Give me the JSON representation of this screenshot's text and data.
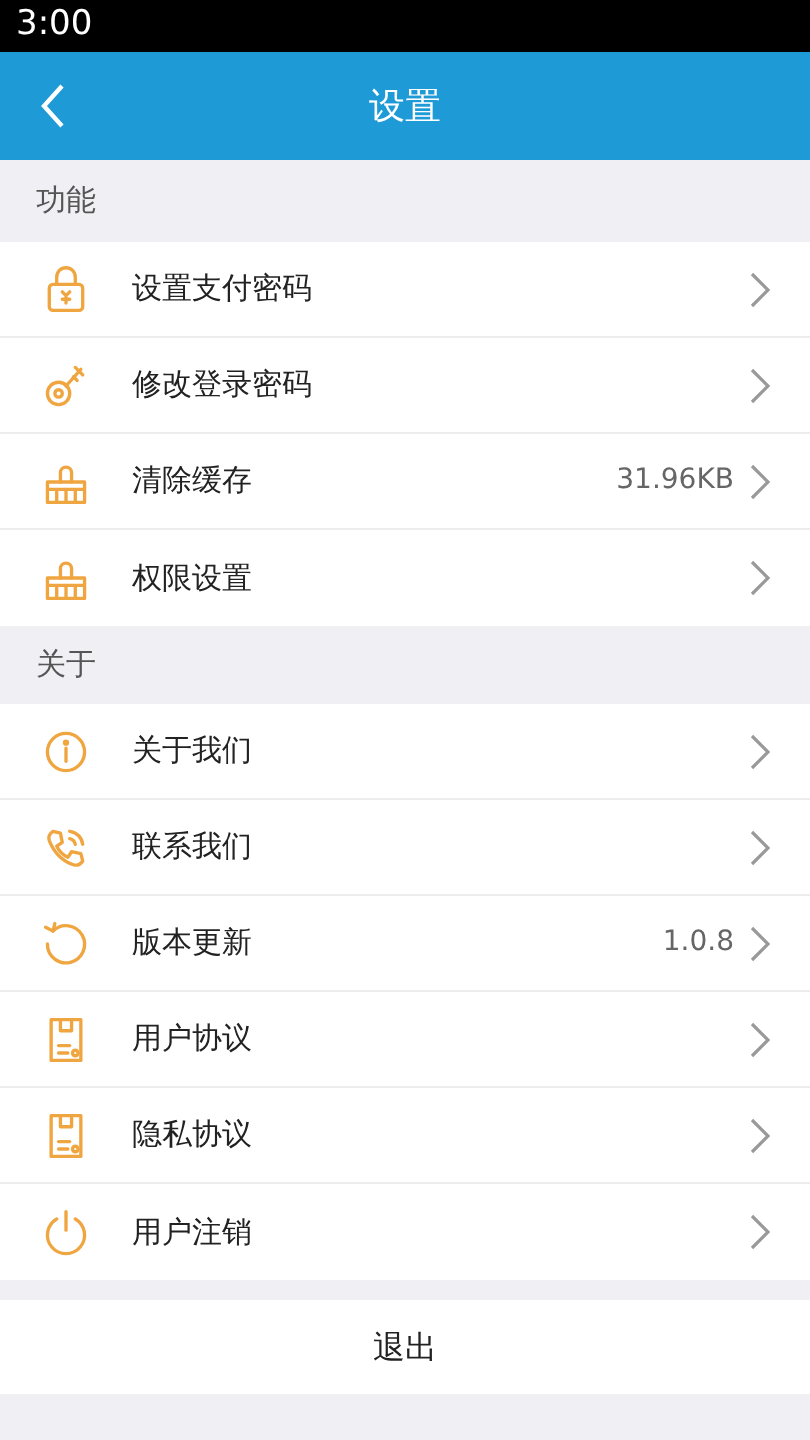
{
  "status_bar": {
    "time": "3:00"
  },
  "header": {
    "title": "设置"
  },
  "sections": [
    {
      "title": "功能",
      "items": [
        {
          "kind": "lock",
          "label": "设置支付密码"
        },
        {
          "kind": "key",
          "label": "修改登录密码"
        },
        {
          "kind": "brush",
          "label": "清除缓存",
          "value": "31.96KB"
        },
        {
          "kind": "brush",
          "label": "权限设置"
        }
      ]
    },
    {
      "title": "关于",
      "items": [
        {
          "kind": "info",
          "label": "关于我们"
        },
        {
          "kind": "phone",
          "label": "联系我们"
        },
        {
          "kind": "refresh",
          "label": "版本更新",
          "value": "1.0.8"
        },
        {
          "kind": "document",
          "label": "用户协议"
        },
        {
          "kind": "document",
          "label": "隐私协议"
        },
        {
          "kind": "power",
          "label": "用户注销"
        }
      ]
    }
  ],
  "logout": "退出"
}
